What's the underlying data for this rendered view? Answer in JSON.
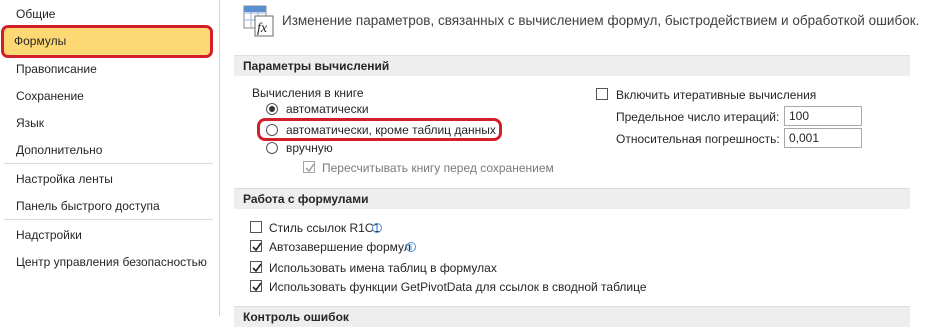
{
  "sidebar": {
    "items": [
      {
        "label": "Общие"
      },
      {
        "label": "Формулы"
      },
      {
        "label": "Правописание"
      },
      {
        "label": "Сохранение"
      },
      {
        "label": "Язык"
      },
      {
        "label": "Дополнительно"
      },
      {
        "label": "Настройка ленты"
      },
      {
        "label": "Панель быстрого доступа"
      },
      {
        "label": "Надстройки"
      },
      {
        "label": "Центр управления безопасностью"
      }
    ],
    "selected": "Формулы"
  },
  "header": {
    "description": "Изменение параметров, связанных с вычислением формул, быстродействием и обработкой ошибок.",
    "icon": "formula-fx-icon"
  },
  "calc_section": {
    "title": "Параметры вычислений",
    "workbook_label": "Вычисления в книге",
    "options": [
      {
        "label": "автоматически",
        "checked": true
      },
      {
        "label": "автоматически, кроме таблиц данных",
        "checked": false
      },
      {
        "label": "вручную",
        "checked": false
      }
    ],
    "recalc_before_save": {
      "label": "Пересчитывать книгу перед сохранением",
      "checked": true,
      "enabled": false
    },
    "iterative": {
      "label": "Включить итеративные вычисления",
      "checked": false
    },
    "max_iterations": {
      "label": "Предельное число итераций:",
      "value": "100"
    },
    "max_change": {
      "label": "Относительная погрешность:",
      "value": "0,001"
    }
  },
  "formulas_section": {
    "title": "Работа с формулами",
    "options": [
      {
        "label": "Стиль ссылок R1C1",
        "checked": false,
        "info": true
      },
      {
        "label": "Автозавершение формул",
        "checked": true,
        "info": true
      },
      {
        "label": "Использовать имена таблиц в формулах",
        "checked": true,
        "info": false
      },
      {
        "label": "Использовать функции GetPivotData для ссылок в сводной таблице",
        "checked": true,
        "info": false
      }
    ]
  },
  "errors_section": {
    "title": "Контроль ошибок"
  },
  "colors": {
    "selected_bg": "#fdd873",
    "highlight_ring": "#d2202a",
    "section_bg": "#eeeeee",
    "info_blue": "#4f8fd6"
  }
}
